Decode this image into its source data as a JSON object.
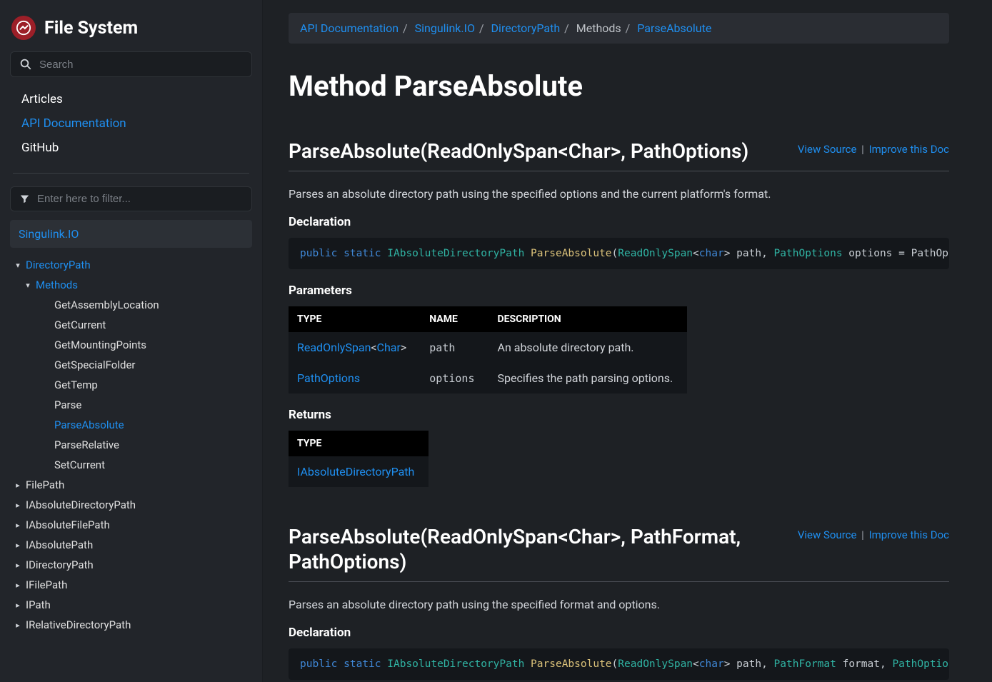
{
  "brand": {
    "title": "File System"
  },
  "search": {
    "placeholder": "Search"
  },
  "filter": {
    "placeholder": "Enter here to filter..."
  },
  "mainNav": {
    "articles": "Articles",
    "api": "API Documentation",
    "github": "GitHub"
  },
  "namespace": "Singulink.IO",
  "tree": {
    "directoryPath": "DirectoryPath",
    "methods": "Methods",
    "methodItems": [
      "GetAssemblyLocation",
      "GetCurrent",
      "GetMountingPoints",
      "GetSpecialFolder",
      "GetTemp",
      "Parse",
      "ParseAbsolute",
      "ParseRelative",
      "SetCurrent"
    ],
    "siblings": [
      "FilePath",
      "IAbsoluteDirectoryPath",
      "IAbsoluteFilePath",
      "IAbsolutePath",
      "IDirectoryPath",
      "IFilePath",
      "IPath",
      "IRelativeDirectoryPath"
    ]
  },
  "breadcrumb": {
    "api": "API Documentation",
    "ns": "Singulink.IO",
    "cls": "DirectoryPath",
    "methods": "Methods",
    "current": "ParseAbsolute"
  },
  "pageTitle": "Method ParseAbsolute",
  "links": {
    "viewSource": "View Source",
    "improve": "Improve this Doc"
  },
  "headers": {
    "declaration": "Declaration",
    "parameters": "Parameters",
    "returns": "Returns",
    "type": "TYPE",
    "name": "NAME",
    "description": "DESCRIPTION"
  },
  "ov1": {
    "title": "ParseAbsolute(ReadOnlySpan<Char>, PathOptions)",
    "desc": "Parses an absolute directory path using the specified options and the current platform's format.",
    "params": [
      {
        "typeParts": [
          "ReadOnlySpan",
          "<",
          "Char",
          ">"
        ],
        "name": "path",
        "desc": "An absolute directory path."
      },
      {
        "typeParts": [
          "PathOptions"
        ],
        "name": "options",
        "desc": "Specifies the path parsing options."
      }
    ],
    "returnType": "IAbsoluteDirectoryPath"
  },
  "ov2": {
    "title": "ParseAbsolute(ReadOnlySpan<Char>, PathFormat, PathOptions)",
    "desc": "Parses an absolute directory path using the specified format and options."
  }
}
